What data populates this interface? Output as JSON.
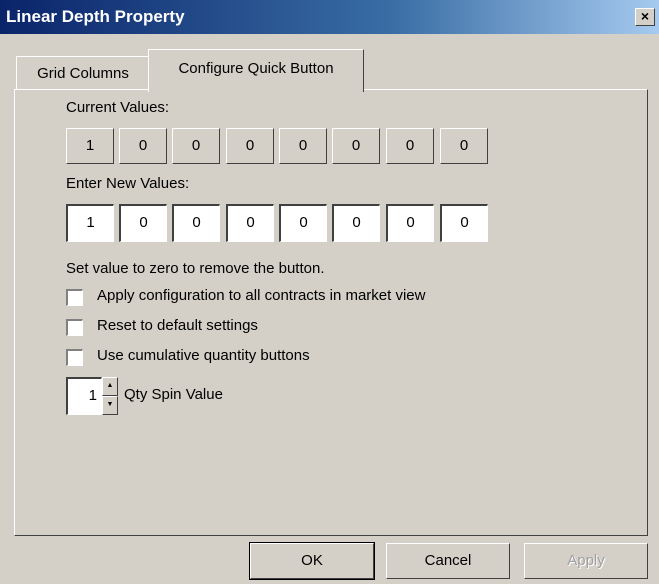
{
  "window": {
    "title": "Linear Depth Property",
    "close_label": "×"
  },
  "tabs": [
    {
      "label": "Grid Columns",
      "active": false
    },
    {
      "label": "Configure Quick Button",
      "active": true
    }
  ],
  "panel": {
    "current_label": "Current Values:",
    "current_values": [
      "1",
      "0",
      "0",
      "0",
      "0",
      "0",
      "0",
      "0"
    ],
    "new_label": "Enter New Values:",
    "new_values": [
      "1",
      "0",
      "0",
      "0",
      "0",
      "0",
      "0",
      "0"
    ],
    "hint": "Set value to zero to remove the button.",
    "checkboxes": [
      {
        "label": "Apply configuration to all contracts in market view",
        "checked": false
      },
      {
        "label": "Reset to default settings",
        "checked": false
      },
      {
        "label": "Use cumulative quantity buttons",
        "checked": false
      }
    ],
    "qty_spin": {
      "value": "1",
      "label": "Qty Spin Value"
    }
  },
  "buttons": {
    "ok": "OK",
    "cancel": "Cancel",
    "apply": "Apply"
  }
}
